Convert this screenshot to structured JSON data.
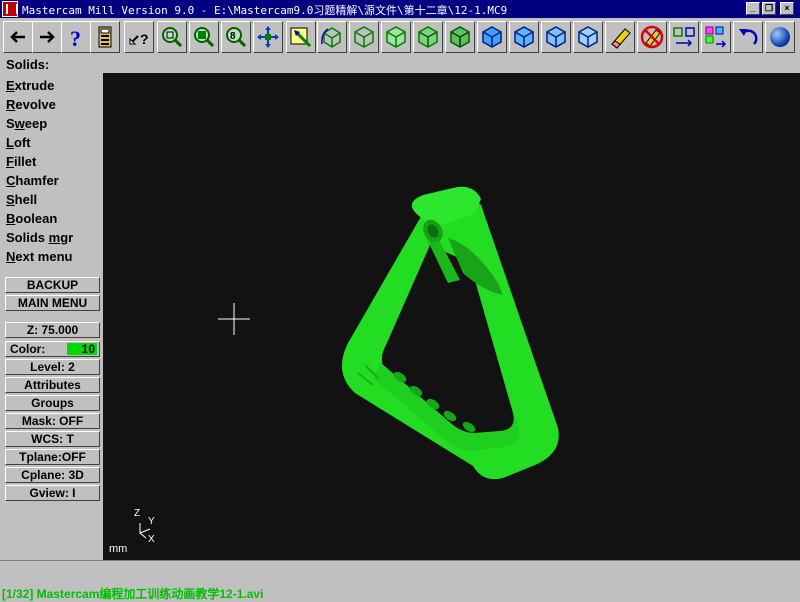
{
  "window": {
    "title": "Mastercam Mill Version 9.0 - E:\\Mastercam9.0习题精解\\源文件\\第十二章\\12-1.MC9",
    "controls": [
      "_",
      "❐",
      "×"
    ]
  },
  "toolbar": {
    "buttons": [
      "back-arrow",
      "forward-arrow",
      "help",
      "calculator",
      "query-analyze",
      "zoom-window",
      "zoom-fit",
      "zoom-unzoom",
      "pan",
      "select-edit",
      "rotate-view",
      "wireframe-cube",
      "iso-cube-green-1",
      "iso-cube-green-2",
      "iso-cube-green-3",
      "cube-blue-1",
      "cube-blue-2",
      "cube-blue-3",
      "cube-blue-4",
      "eraser",
      "no-symbol",
      "transform-1",
      "transform-2",
      "undo",
      "sphere"
    ]
  },
  "prompt": {
    "text": "Solids:"
  },
  "menu": {
    "items": [
      {
        "pre": "",
        "hot": "E",
        "post": "xtrude"
      },
      {
        "pre": "",
        "hot": "R",
        "post": "evolve"
      },
      {
        "pre": "S",
        "hot": "w",
        "post": "eep"
      },
      {
        "pre": "",
        "hot": "L",
        "post": "oft"
      },
      {
        "pre": "",
        "hot": "F",
        "post": "illet"
      },
      {
        "pre": "",
        "hot": "C",
        "post": "hamfer"
      },
      {
        "pre": "",
        "hot": "S",
        "post": "hell"
      },
      {
        "pre": "",
        "hot": "B",
        "post": "oolean"
      },
      {
        "pre": "Solids ",
        "hot": "m",
        "post": "gr"
      },
      {
        "pre": "",
        "hot": "N",
        "post": "ext menu"
      }
    ],
    "backup": "BACKUP",
    "main_menu": "MAIN MENU"
  },
  "secondary": {
    "z": "Z:  75.000",
    "color_label": "Color:",
    "color_value": "10",
    "level": "Level:  2",
    "attributes": "Attributes",
    "groups": "Groups",
    "mask": "Mask:  OFF",
    "wcs": "WCS:   T",
    "tplane": "Tplane:OFF",
    "cplane": "Cplane: 3D",
    "gview": "Gview:   I"
  },
  "viewport": {
    "units": "mm",
    "axis": {
      "z": "Z",
      "y": "Y",
      "x": "X"
    },
    "model_color": "#22dd22"
  },
  "status": {
    "subtitle": "[1/32] Mastercam编程加工训练动画教学12-1.avi"
  }
}
